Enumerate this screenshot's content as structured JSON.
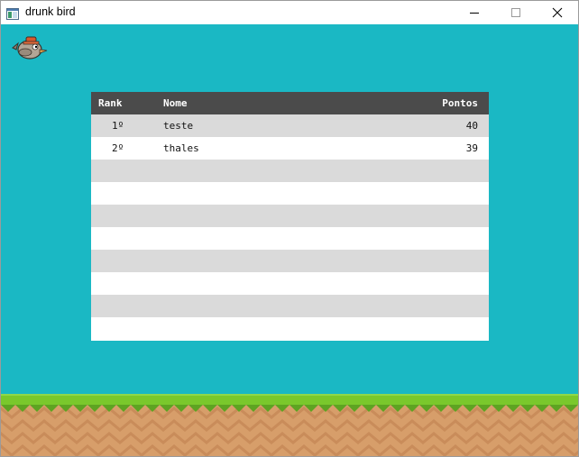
{
  "window": {
    "title": "drunk bird",
    "icon": "app-window-icon",
    "controls": [
      "minimize-icon",
      "maximize-icon",
      "close-icon"
    ]
  },
  "game": {
    "background_color": "#1ab8c4",
    "sprite": "bird-icon",
    "ground_grass_color": "#7ac82c",
    "ground_dirt_color": "#d79e6a"
  },
  "ranking": {
    "header": {
      "rank": "Rank",
      "name": "Nome",
      "points": "Pontos"
    },
    "rows": [
      {
        "rank": "1º",
        "name": "teste",
        "points": "40"
      },
      {
        "rank": "2º",
        "name": "thales",
        "points": "39"
      },
      {
        "rank": "",
        "name": "",
        "points": ""
      },
      {
        "rank": "",
        "name": "",
        "points": ""
      },
      {
        "rank": "",
        "name": "",
        "points": ""
      },
      {
        "rank": "",
        "name": "",
        "points": ""
      },
      {
        "rank": "",
        "name": "",
        "points": ""
      },
      {
        "rank": "",
        "name": "",
        "points": ""
      },
      {
        "rank": "",
        "name": "",
        "points": ""
      },
      {
        "rank": "",
        "name": "",
        "points": ""
      }
    ],
    "header_color": "#4b4b4b",
    "stripe_color": "#dadada"
  }
}
